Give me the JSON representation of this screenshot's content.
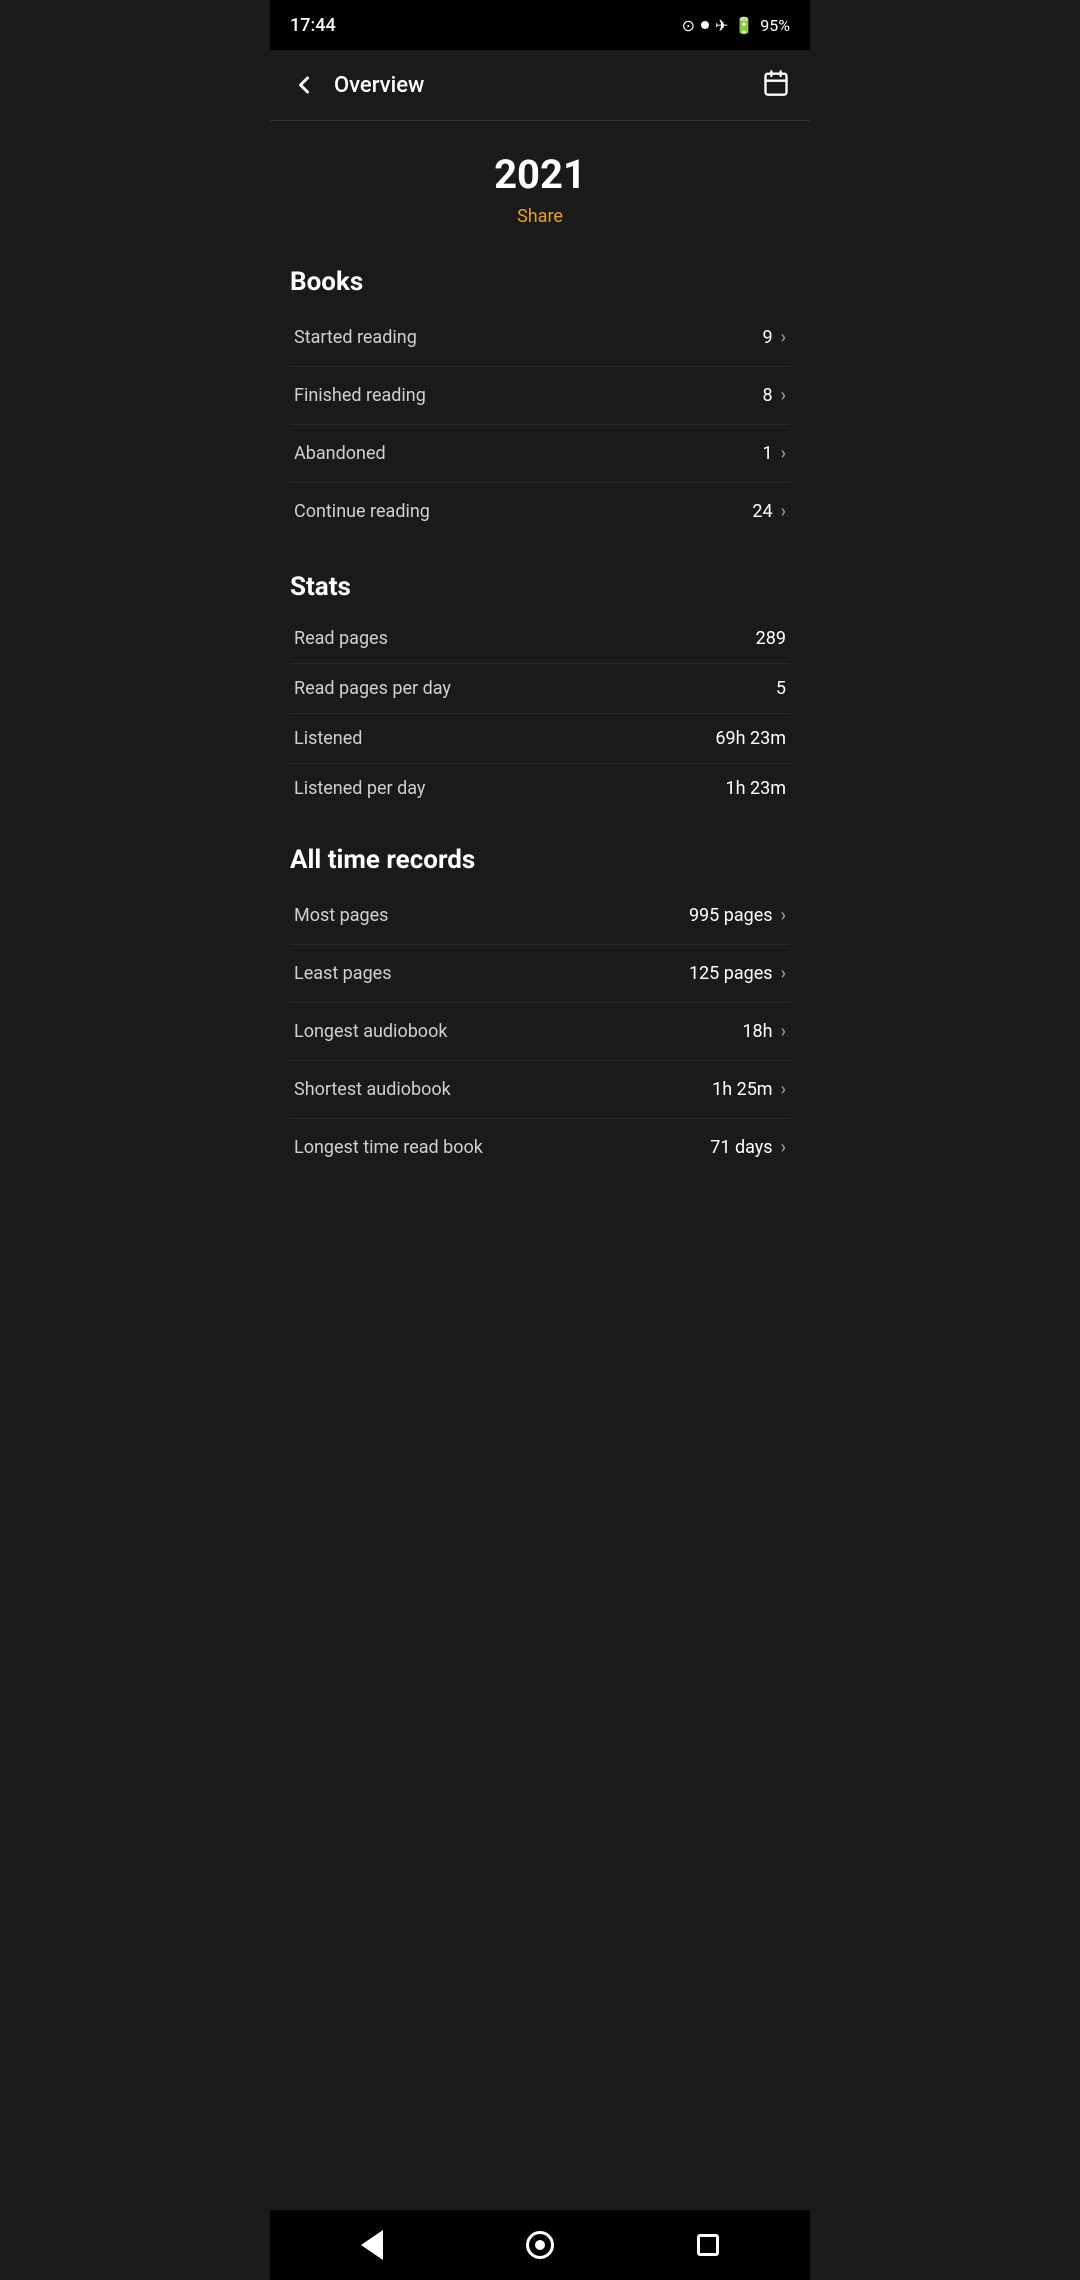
{
  "statusBar": {
    "time": "17:44",
    "dot": "•",
    "battery": "95%"
  },
  "header": {
    "back_label": "←",
    "title": "Overview",
    "calendar_icon": "calendar-icon"
  },
  "year": {
    "value": "2021",
    "share_label": "Share"
  },
  "books": {
    "section_title": "Books",
    "items": [
      {
        "label": "Started reading",
        "value": "9"
      },
      {
        "label": "Finished reading",
        "value": "8"
      },
      {
        "label": "Abandoned",
        "value": "1"
      },
      {
        "label": "Continue reading",
        "value": "24"
      }
    ]
  },
  "stats": {
    "section_title": "Stats",
    "items": [
      {
        "label": "Read pages",
        "value": "289"
      },
      {
        "label": "Read pages per day",
        "value": "5"
      },
      {
        "label": "Listened",
        "value": "69h 23m"
      },
      {
        "label": "Listened per day",
        "value": "1h 23m"
      }
    ]
  },
  "allTimeRecords": {
    "section_title": "All time records",
    "items": [
      {
        "label": "Most pages",
        "value": "995 pages"
      },
      {
        "label": "Least pages",
        "value": "125 pages"
      },
      {
        "label": "Longest audiobook",
        "value": "18h"
      },
      {
        "label": "Shortest audiobook",
        "value": "1h 25m"
      },
      {
        "label": "Longest time read book",
        "value": "71 days"
      }
    ]
  },
  "bottomNav": {
    "back_title": "back",
    "home_title": "home",
    "recent_title": "recent"
  }
}
